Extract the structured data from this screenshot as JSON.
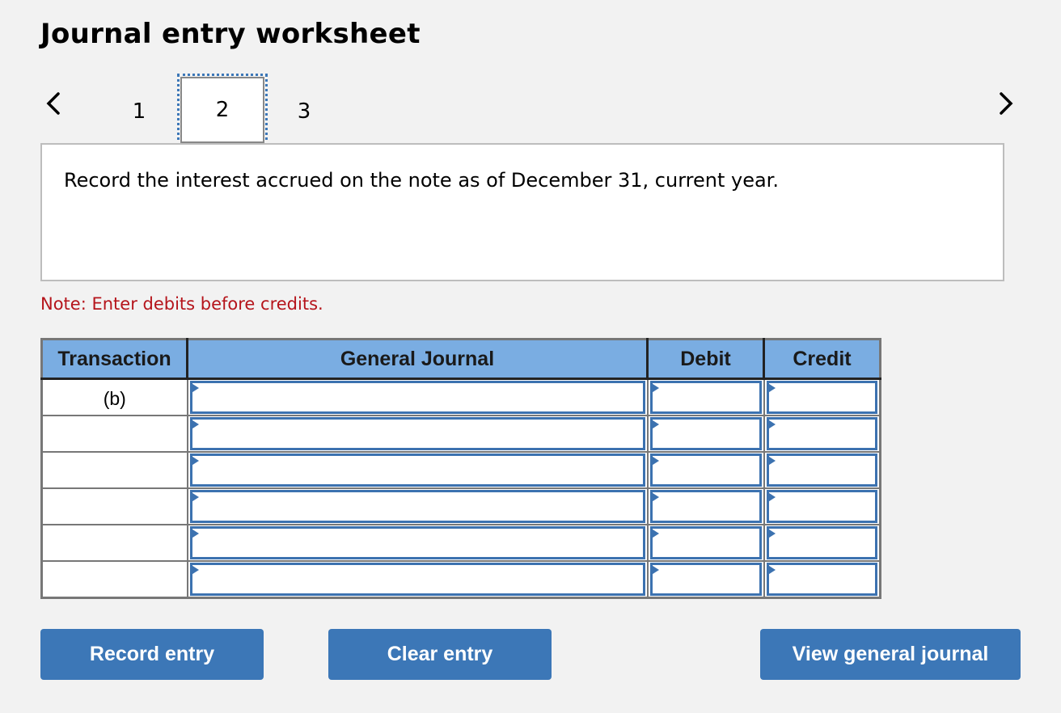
{
  "header": {
    "title": "Journal entry worksheet"
  },
  "navigation": {
    "prev_icon": "chevron-left-icon",
    "next_icon": "chevron-right-icon",
    "steps": [
      {
        "label": "1",
        "active": false
      },
      {
        "label": "2",
        "active": true
      },
      {
        "label": "3",
        "active": false
      }
    ]
  },
  "prompt": {
    "text": "Record the interest accrued on the note as of December 31, current year."
  },
  "note": {
    "text": "Note: Enter debits before credits.",
    "color": "#b5141b"
  },
  "table": {
    "headers": [
      "Transaction",
      "General Journal",
      "Debit",
      "Credit"
    ],
    "rows": [
      {
        "transaction": "(b)",
        "account": "",
        "debit": "",
        "credit": ""
      },
      {
        "transaction": "",
        "account": "",
        "debit": "",
        "credit": ""
      },
      {
        "transaction": "",
        "account": "",
        "debit": "",
        "credit": ""
      },
      {
        "transaction": "",
        "account": "",
        "debit": "",
        "credit": ""
      },
      {
        "transaction": "",
        "account": "",
        "debit": "",
        "credit": ""
      },
      {
        "transaction": "",
        "account": "",
        "debit": "",
        "credit": ""
      }
    ],
    "header_color": "#7aade2",
    "input_border_color": "#3c72b0"
  },
  "buttons": {
    "record": "Record entry",
    "clear": "Clear entry",
    "view": "View general journal",
    "color": "#3c77b7"
  }
}
